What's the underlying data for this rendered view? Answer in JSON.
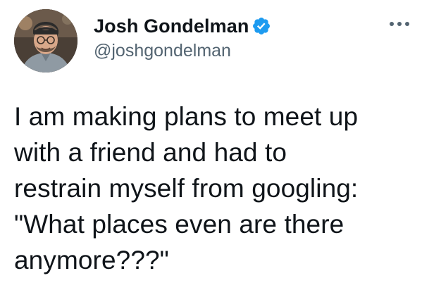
{
  "tweet": {
    "author": {
      "name": "Josh Gondelman",
      "handle": "@joshgondelman",
      "verified": true,
      "avatar_icon": "profile-photo"
    },
    "more_icon": "more-horizontal-icon",
    "text_lines": [
      "I am making plans to meet up",
      "with a friend and had to",
      "restrain myself from googling:",
      "\"What places even are there",
      "anymore???\""
    ]
  },
  "colors": {
    "text": "#0f1419",
    "secondary_text": "#536471",
    "verified_blue": "#1d9bf0",
    "background": "#ffffff"
  }
}
